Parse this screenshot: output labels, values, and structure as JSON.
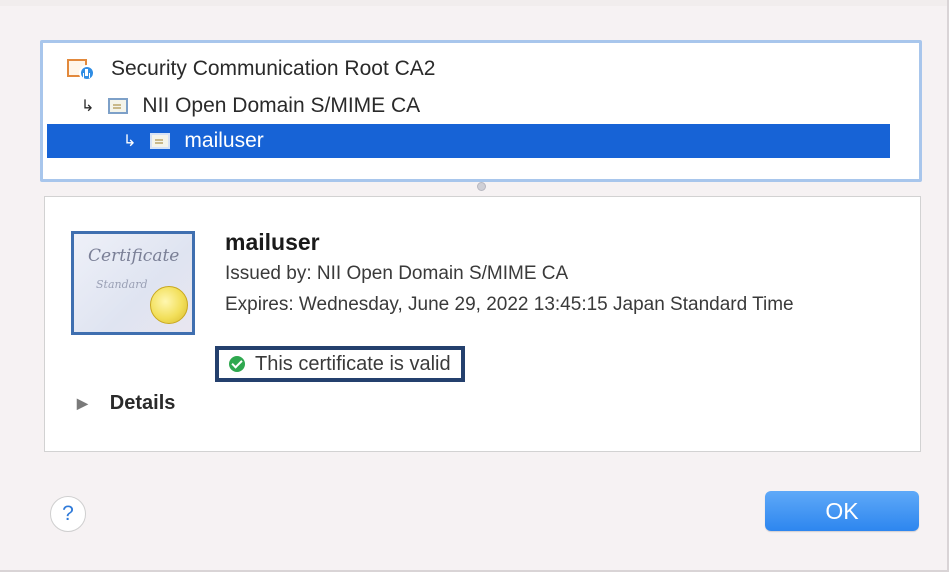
{
  "chain": {
    "root": {
      "label": "Security Communication Root CA2",
      "icon": "root-certificate-icon"
    },
    "intermediate": {
      "label": "NII Open Domain S/MIME CA",
      "icon": "certificate-icon"
    },
    "leaf": {
      "label": "mailuser",
      "icon": "certificate-icon",
      "selected": true
    },
    "arrow": "↳"
  },
  "detail": {
    "name": "mailuser",
    "issued_by": "Issued by: NII Open Domain S/MIME CA",
    "expires": "Expires: Wednesday, June 29, 2022 13:45:15 Japan Standard Time",
    "status": "This certificate is valid",
    "status_color": "#2fa84f",
    "details_label": "Details",
    "certificate_image_text": "Certificate",
    "certificate_image_subtext": "Standard"
  },
  "buttons": {
    "help": "?",
    "ok": "OK"
  },
  "colors": {
    "selection": "#1763d6",
    "chain_border": "#a8c6ec",
    "highlight_border": "#24406d",
    "ok_button": "#2d86ef"
  }
}
